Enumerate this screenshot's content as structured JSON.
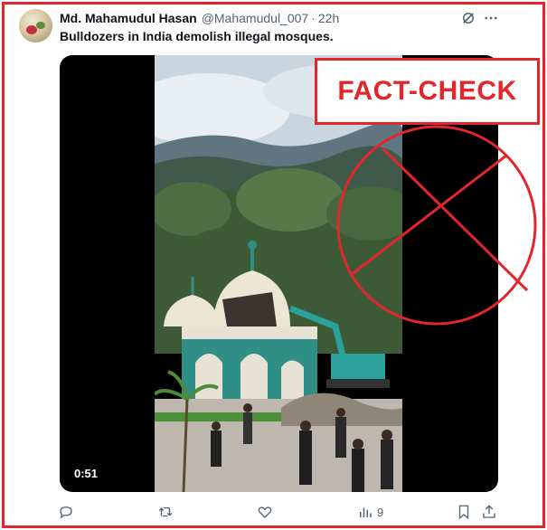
{
  "tweet": {
    "name": "Md. Mahamudul Hasan",
    "handle": "@Mahamudul_007",
    "separator": "·",
    "time": "22h",
    "text": "Bulldozers in India demolish illegal mosques."
  },
  "media": {
    "duration": "0:51",
    "overlay_label": "FACT-CHECK",
    "overlay_color": "#e3262b"
  },
  "actions": {
    "views_count": "9"
  },
  "icons": [
    "grok-icon",
    "more-icon",
    "reply-icon",
    "retweet-icon",
    "like-icon",
    "views-icon",
    "bookmark-icon",
    "share-icon"
  ]
}
